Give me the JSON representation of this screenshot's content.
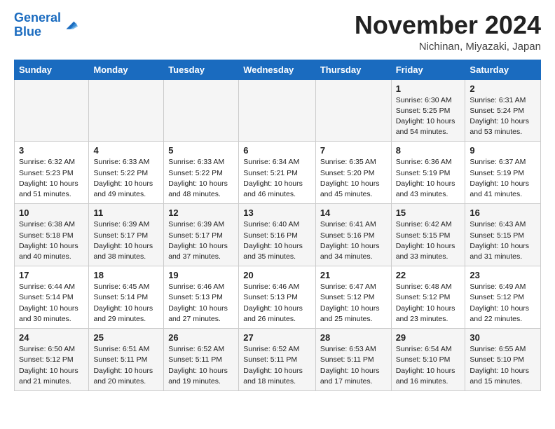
{
  "header": {
    "logo_line1": "General",
    "logo_line2": "Blue",
    "main_title": "November 2024",
    "subtitle": "Nichinan, Miyazaki, Japan"
  },
  "weekdays": [
    "Sunday",
    "Monday",
    "Tuesday",
    "Wednesday",
    "Thursday",
    "Friday",
    "Saturday"
  ],
  "rows": [
    [
      {
        "day": "",
        "info": ""
      },
      {
        "day": "",
        "info": ""
      },
      {
        "day": "",
        "info": ""
      },
      {
        "day": "",
        "info": ""
      },
      {
        "day": "",
        "info": ""
      },
      {
        "day": "1",
        "info": "Sunrise: 6:30 AM\nSunset: 5:25 PM\nDaylight: 10 hours\nand 54 minutes."
      },
      {
        "day": "2",
        "info": "Sunrise: 6:31 AM\nSunset: 5:24 PM\nDaylight: 10 hours\nand 53 minutes."
      }
    ],
    [
      {
        "day": "3",
        "info": "Sunrise: 6:32 AM\nSunset: 5:23 PM\nDaylight: 10 hours\nand 51 minutes."
      },
      {
        "day": "4",
        "info": "Sunrise: 6:33 AM\nSunset: 5:22 PM\nDaylight: 10 hours\nand 49 minutes."
      },
      {
        "day": "5",
        "info": "Sunrise: 6:33 AM\nSunset: 5:22 PM\nDaylight: 10 hours\nand 48 minutes."
      },
      {
        "day": "6",
        "info": "Sunrise: 6:34 AM\nSunset: 5:21 PM\nDaylight: 10 hours\nand 46 minutes."
      },
      {
        "day": "7",
        "info": "Sunrise: 6:35 AM\nSunset: 5:20 PM\nDaylight: 10 hours\nand 45 minutes."
      },
      {
        "day": "8",
        "info": "Sunrise: 6:36 AM\nSunset: 5:19 PM\nDaylight: 10 hours\nand 43 minutes."
      },
      {
        "day": "9",
        "info": "Sunrise: 6:37 AM\nSunset: 5:19 PM\nDaylight: 10 hours\nand 41 minutes."
      }
    ],
    [
      {
        "day": "10",
        "info": "Sunrise: 6:38 AM\nSunset: 5:18 PM\nDaylight: 10 hours\nand 40 minutes."
      },
      {
        "day": "11",
        "info": "Sunrise: 6:39 AM\nSunset: 5:17 PM\nDaylight: 10 hours\nand 38 minutes."
      },
      {
        "day": "12",
        "info": "Sunrise: 6:39 AM\nSunset: 5:17 PM\nDaylight: 10 hours\nand 37 minutes."
      },
      {
        "day": "13",
        "info": "Sunrise: 6:40 AM\nSunset: 5:16 PM\nDaylight: 10 hours\nand 35 minutes."
      },
      {
        "day": "14",
        "info": "Sunrise: 6:41 AM\nSunset: 5:16 PM\nDaylight: 10 hours\nand 34 minutes."
      },
      {
        "day": "15",
        "info": "Sunrise: 6:42 AM\nSunset: 5:15 PM\nDaylight: 10 hours\nand 33 minutes."
      },
      {
        "day": "16",
        "info": "Sunrise: 6:43 AM\nSunset: 5:15 PM\nDaylight: 10 hours\nand 31 minutes."
      }
    ],
    [
      {
        "day": "17",
        "info": "Sunrise: 6:44 AM\nSunset: 5:14 PM\nDaylight: 10 hours\nand 30 minutes."
      },
      {
        "day": "18",
        "info": "Sunrise: 6:45 AM\nSunset: 5:14 PM\nDaylight: 10 hours\nand 29 minutes."
      },
      {
        "day": "19",
        "info": "Sunrise: 6:46 AM\nSunset: 5:13 PM\nDaylight: 10 hours\nand 27 minutes."
      },
      {
        "day": "20",
        "info": "Sunrise: 6:46 AM\nSunset: 5:13 PM\nDaylight: 10 hours\nand 26 minutes."
      },
      {
        "day": "21",
        "info": "Sunrise: 6:47 AM\nSunset: 5:12 PM\nDaylight: 10 hours\nand 25 minutes."
      },
      {
        "day": "22",
        "info": "Sunrise: 6:48 AM\nSunset: 5:12 PM\nDaylight: 10 hours\nand 23 minutes."
      },
      {
        "day": "23",
        "info": "Sunrise: 6:49 AM\nSunset: 5:12 PM\nDaylight: 10 hours\nand 22 minutes."
      }
    ],
    [
      {
        "day": "24",
        "info": "Sunrise: 6:50 AM\nSunset: 5:12 PM\nDaylight: 10 hours\nand 21 minutes."
      },
      {
        "day": "25",
        "info": "Sunrise: 6:51 AM\nSunset: 5:11 PM\nDaylight: 10 hours\nand 20 minutes."
      },
      {
        "day": "26",
        "info": "Sunrise: 6:52 AM\nSunset: 5:11 PM\nDaylight: 10 hours\nand 19 minutes."
      },
      {
        "day": "27",
        "info": "Sunrise: 6:52 AM\nSunset: 5:11 PM\nDaylight: 10 hours\nand 18 minutes."
      },
      {
        "day": "28",
        "info": "Sunrise: 6:53 AM\nSunset: 5:11 PM\nDaylight: 10 hours\nand 17 minutes."
      },
      {
        "day": "29",
        "info": "Sunrise: 6:54 AM\nSunset: 5:10 PM\nDaylight: 10 hours\nand 16 minutes."
      },
      {
        "day": "30",
        "info": "Sunrise: 6:55 AM\nSunset: 5:10 PM\nDaylight: 10 hours\nand 15 minutes."
      }
    ]
  ]
}
